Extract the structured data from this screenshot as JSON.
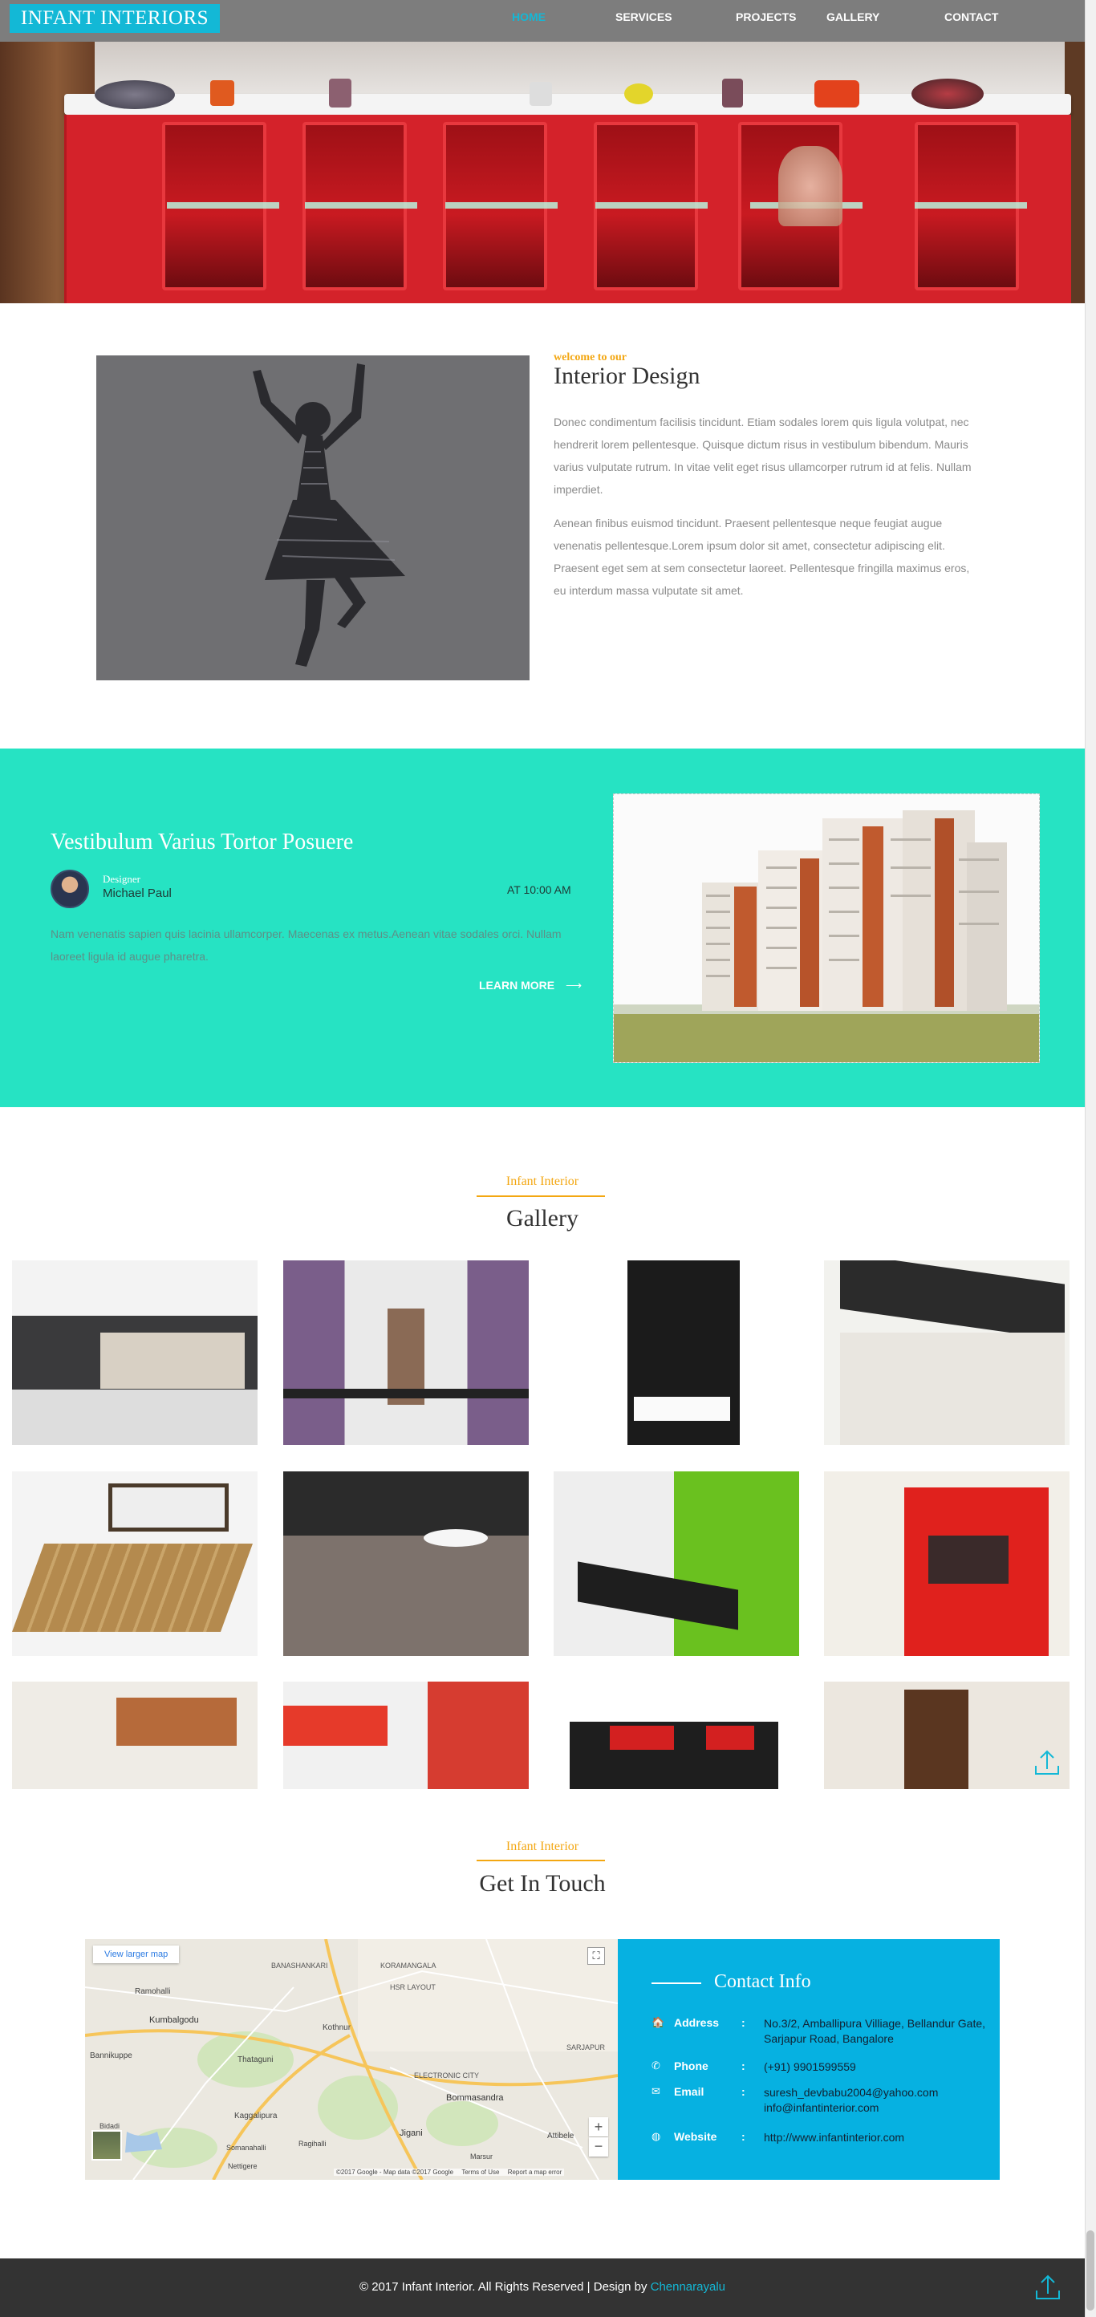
{
  "nav": {
    "logo": "INFANT INTERIORS",
    "items": [
      "HOME",
      "SERVICES",
      "PROJECTS",
      "GALLERY",
      "CONTACT"
    ],
    "active": "HOME"
  },
  "about": {
    "kicker": "welcome to our",
    "title": "Interior Design",
    "p1": "Donec condimentum facilisis tincidunt. Etiam sodales lorem quis ligula volutpat, nec hendrerit lorem pellentesque. Quisque dictum risus in vestibulum bibendum. Mauris varius vulputate rutrum. In vitae velit eget risus ullamcorper rutrum id at felis. Nullam imperdiet.",
    "p2": "Aenean finibus euismod tincidunt. Praesent pellentesque neque feugiat augue venenatis pellentesque.Lorem ipsum dolor sit amet, consectetur adipiscing elit. Praesent eget sem at sem consectetur laoreet. Pellentesque fringilla maximus eros, eu interdum massa vulputate sit amet."
  },
  "feature": {
    "title": "Vestibulum Varius Tortor Posuere",
    "role": "Designer",
    "person": "Michael Paul",
    "time": "AT 10:00 AM",
    "text": "Nam venenatis sapien quis lacinia ullamcorper. Maecenas ex metus.Aenean vitae sodales orci. Nullam laoreet ligula id augue pharetra.",
    "cta": "LEARN MORE"
  },
  "gallery": {
    "kicker": "Infant Interior",
    "title": "Gallery"
  },
  "contact": {
    "kicker": "Infant Interior",
    "title": "Get In Touch",
    "map": {
      "larger": "View larger map",
      "places": [
        "BANASHANKARI",
        "KORAMANGALA",
        "HSR LAYOUT",
        "Ramohalli",
        "Kumbalgodu",
        "Kothnur",
        "Bannikuppe",
        "Thataguni",
        "SARJAPUR",
        "ELECTRONIC CITY",
        "Bommasandra",
        "Kaggalipura",
        "Jigani",
        "Bidadi",
        "Somanahalli",
        "Ragihalli",
        "Attibele",
        "Nettigere",
        "Marsur"
      ],
      "attribution": "©2017 Google - Map data ©2017 Google",
      "terms": "Terms of Use",
      "report": "Report a map error"
    },
    "info_title": "Contact Info",
    "rows": [
      {
        "icon": "home-icon",
        "glyph": "🏠",
        "label": "Address",
        "sep": ":",
        "value": "No.3/2, Amballipura Villiage, Bellandur Gate, Sarjapur Road, Bangalore"
      },
      {
        "icon": "phone-icon",
        "glyph": "✆",
        "label": "Phone",
        "sep": ":",
        "value": "(+91) 9901599559"
      },
      {
        "icon": "envelope-icon",
        "glyph": "✉",
        "label": "Email",
        "sep": ":",
        "value": "suresh_devbabu2004@yahoo.com info@infantinterior.com"
      },
      {
        "icon": "globe-icon",
        "glyph": "◍",
        "label": "Website",
        "sep": ":",
        "value": "http://www.infantinterior.com"
      }
    ]
  },
  "footer": {
    "copy": "© 2017 Infant Interior. All Rights Reserved | Design by ",
    "credit": "Chennarayalu"
  },
  "colors": {
    "accent": "#13b8d6",
    "teal": "#26e3c3",
    "gold": "#f3a712",
    "info": "#06b1e1",
    "footer": "#333333"
  }
}
